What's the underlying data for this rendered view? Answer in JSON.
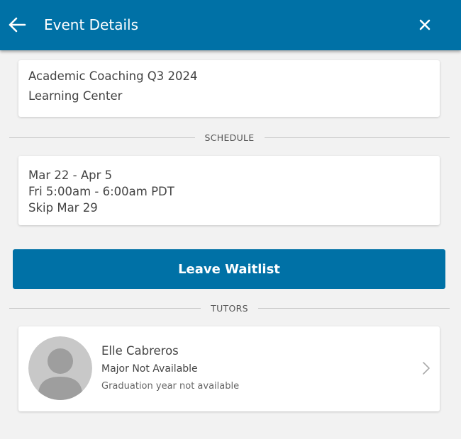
{
  "header": {
    "title": "Event Details",
    "back_icon": "arrow-left-icon",
    "close_icon": "close-icon"
  },
  "event": {
    "name": "Academic Coaching Q3 2024",
    "location": "Learning Center"
  },
  "schedule": {
    "section_label": "SCHEDULE",
    "date_range": "Mar 22 - Apr 5",
    "time": "Fri 5:00am - 6:00am PDT",
    "skip": "Skip Mar 29"
  },
  "actions": {
    "leave_waitlist_label": "Leave Waitlist"
  },
  "tutors": {
    "section_label": "TUTORS",
    "items": [
      {
        "name": "Elle Cabreros",
        "major": "Major Not Available",
        "graduation": "Graduation year not available",
        "avatar_icon": "person-placeholder-icon"
      }
    ]
  },
  "colors": {
    "primary": "#0071a6",
    "background": "#f2f2f2",
    "card": "#ffffff"
  }
}
